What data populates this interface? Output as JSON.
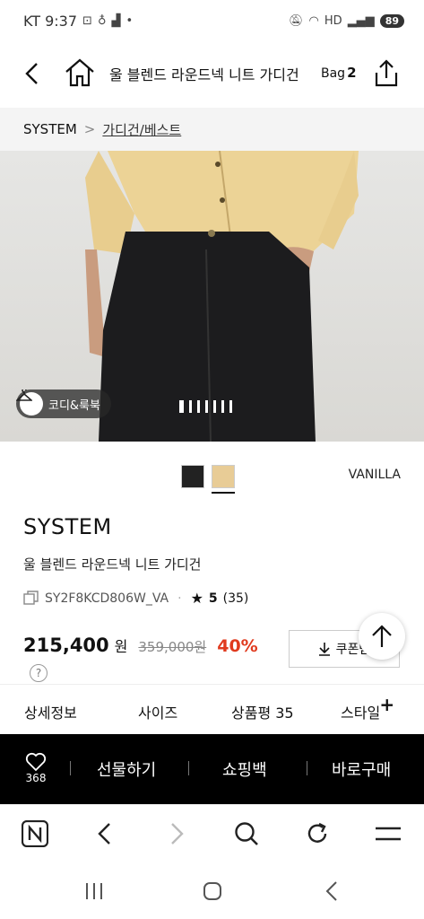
{
  "status": {
    "carrier_time": "KT 9:37",
    "battery": "89",
    "hd": "HD"
  },
  "header": {
    "title": "울 블렌드 라운드넥 니트 가디건",
    "bag_label": "Bag",
    "bag_count": "2"
  },
  "breadcrumb": {
    "brand": "SYSTEM",
    "separator": ">",
    "category": "가디건/베스트"
  },
  "hero": {
    "badge_label": "코디&룩북",
    "page_count": 7,
    "active_index": 0
  },
  "product": {
    "colors": [
      {
        "name": "BLACK",
        "hex": "#222222"
      },
      {
        "name": "VANILLA",
        "hex": "#e8cc96"
      }
    ],
    "selected_color": "VANILLA",
    "brand": "SYSTEM",
    "name": "울 블렌드 라운드넥 니트 가디건",
    "code": "SY2F8KCD806W_VA",
    "dot": "·",
    "rating": "5",
    "review_count": "(35)",
    "price": "215,400",
    "currency": "원",
    "original_price": "359,000원",
    "discount": "40%",
    "coupon_label": "쿠폰받",
    "help_label": "?"
  },
  "tabs": [
    {
      "label": "상세정보"
    },
    {
      "label": "사이즈"
    },
    {
      "label": "상품평 35"
    },
    {
      "label": "스타일"
    }
  ],
  "tabs_plus": "+",
  "buybar": {
    "wish_count": "368",
    "gift_label": "선물하기",
    "cart_label": "쇼핑백",
    "buy_label": "바로구매"
  },
  "icons": {
    "back": "chevron-left-icon",
    "home": "home-icon",
    "share": "share-icon",
    "heart": "heart-icon",
    "hanger": "hanger-icon"
  },
  "colors": {
    "discount": "#e03a1e",
    "buybar_bg": "#000000",
    "breadcrumb_bg": "#f4f4f4"
  }
}
